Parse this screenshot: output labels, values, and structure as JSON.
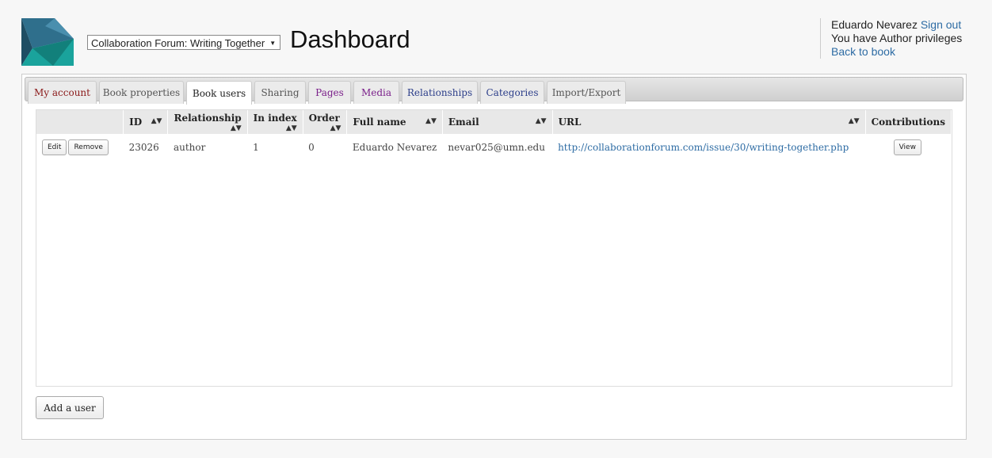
{
  "header": {
    "book_select": "Collaboration Forum: Writing Together",
    "title": "Dashboard"
  },
  "user": {
    "name": "Eduardo Nevarez",
    "sign_out": "Sign out",
    "privileges": "You have Author privileges",
    "back_to_book": "Back to book"
  },
  "tabs": [
    {
      "label": "My account",
      "color": "#8b1a1a"
    },
    {
      "label": "Book properties",
      "color": "#555555"
    },
    {
      "label": "Book users",
      "color": "#222222"
    },
    {
      "label": "Sharing",
      "color": "#555555"
    },
    {
      "label": "Pages",
      "color": "#7a1f8a"
    },
    {
      "label": "Media",
      "color": "#7a1f8a"
    },
    {
      "label": "Relationships",
      "color": "#2c3e8a"
    },
    {
      "label": "Categories",
      "color": "#2c3e8a"
    },
    {
      "label": "Import/Export",
      "color": "#555555"
    }
  ],
  "active_tab": "Book users",
  "table": {
    "columns": [
      "",
      "ID",
      "Relationship",
      "In index",
      "Order",
      "Full name",
      "Email",
      "URL",
      "Contributions"
    ],
    "rows": [
      {
        "edit": "Edit",
        "remove": "Remove",
        "id": "23026",
        "relationship": "author",
        "in_index": "1",
        "order": "0",
        "full_name": "Eduardo Nevarez",
        "email": "nevar025@umn.edu",
        "url": "http://collaborationforum.com/issue/30/writing-together.php",
        "view": "View"
      }
    ]
  },
  "add_user": "Add a user"
}
